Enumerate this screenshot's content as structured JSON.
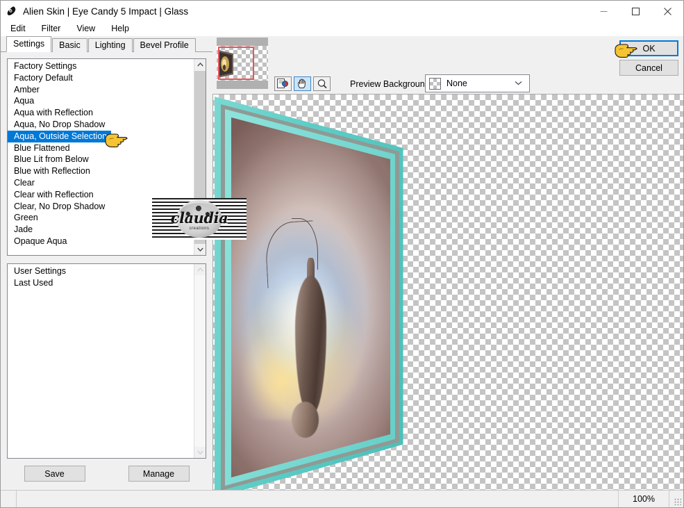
{
  "window": {
    "title": "Alien Skin | Eye Candy 5 Impact | Glass",
    "app_icon": "alien-head-icon",
    "controls": {
      "minimize": "—",
      "maximize": "☐",
      "close": "✕"
    }
  },
  "menubar": {
    "items": [
      {
        "label": "Edit"
      },
      {
        "label": "Filter"
      },
      {
        "label": "View"
      },
      {
        "label": "Help"
      }
    ]
  },
  "tabs": [
    {
      "label": "Settings",
      "active": true
    },
    {
      "label": "Basic",
      "active": false
    },
    {
      "label": "Lighting",
      "active": false
    },
    {
      "label": "Bevel Profile",
      "active": false
    }
  ],
  "settings_list": {
    "items": [
      {
        "label": "Factory Settings",
        "selected": false
      },
      {
        "label": "Factory Default",
        "selected": false
      },
      {
        "label": "Amber",
        "selected": false
      },
      {
        "label": "Aqua",
        "selected": false
      },
      {
        "label": "Aqua with Reflection",
        "selected": false
      },
      {
        "label": "Aqua, No Drop Shadow",
        "selected": false
      },
      {
        "label": "Aqua, Outside Selection",
        "selected": true
      },
      {
        "label": "Blue Flattened",
        "selected": false
      },
      {
        "label": "Blue Lit from Below",
        "selected": false
      },
      {
        "label": "Blue with Reflection",
        "selected": false
      },
      {
        "label": "Clear",
        "selected": false
      },
      {
        "label": "Clear with Reflection",
        "selected": false
      },
      {
        "label": "Clear, No Drop Shadow",
        "selected": false
      },
      {
        "label": "Green",
        "selected": false
      },
      {
        "label": "Jade",
        "selected": false
      },
      {
        "label": "Opaque Aqua",
        "selected": false
      }
    ],
    "scroll_up_icon": "chevron-up-icon",
    "scroll_down_icon": "chevron-down-icon"
  },
  "user_list": {
    "items": [
      {
        "label": "User Settings"
      },
      {
        "label": "Last Used"
      }
    ]
  },
  "buttons": {
    "save": "Save",
    "manage": "Manage",
    "ok": "OK",
    "cancel": "Cancel"
  },
  "toolbar": {
    "tools": [
      {
        "name": "preview-compare-icon",
        "label": "Preview Compare",
        "active": false
      },
      {
        "name": "hand-pan-icon",
        "label": "Pan",
        "active": true
      },
      {
        "name": "zoom-magnifier-icon",
        "label": "Zoom",
        "active": false
      }
    ],
    "preview_background_label": "Preview Background:",
    "preview_background_value": "None",
    "caret_icon": "chevron-down-icon"
  },
  "statusbar": {
    "zoom": "100%"
  },
  "watermark": {
    "text": "claudia",
    "subtext": "creations"
  },
  "colors": {
    "accent": "#0078d7",
    "selection": "#0078d7",
    "frame_teal": "#5dd4cc",
    "window_bg": "#f0f0f0",
    "navigator_rect": "#e8545a"
  },
  "cursors": [
    {
      "name": "pointing-hand-cursor-ok"
    },
    {
      "name": "pointing-hand-cursor-list"
    }
  ]
}
